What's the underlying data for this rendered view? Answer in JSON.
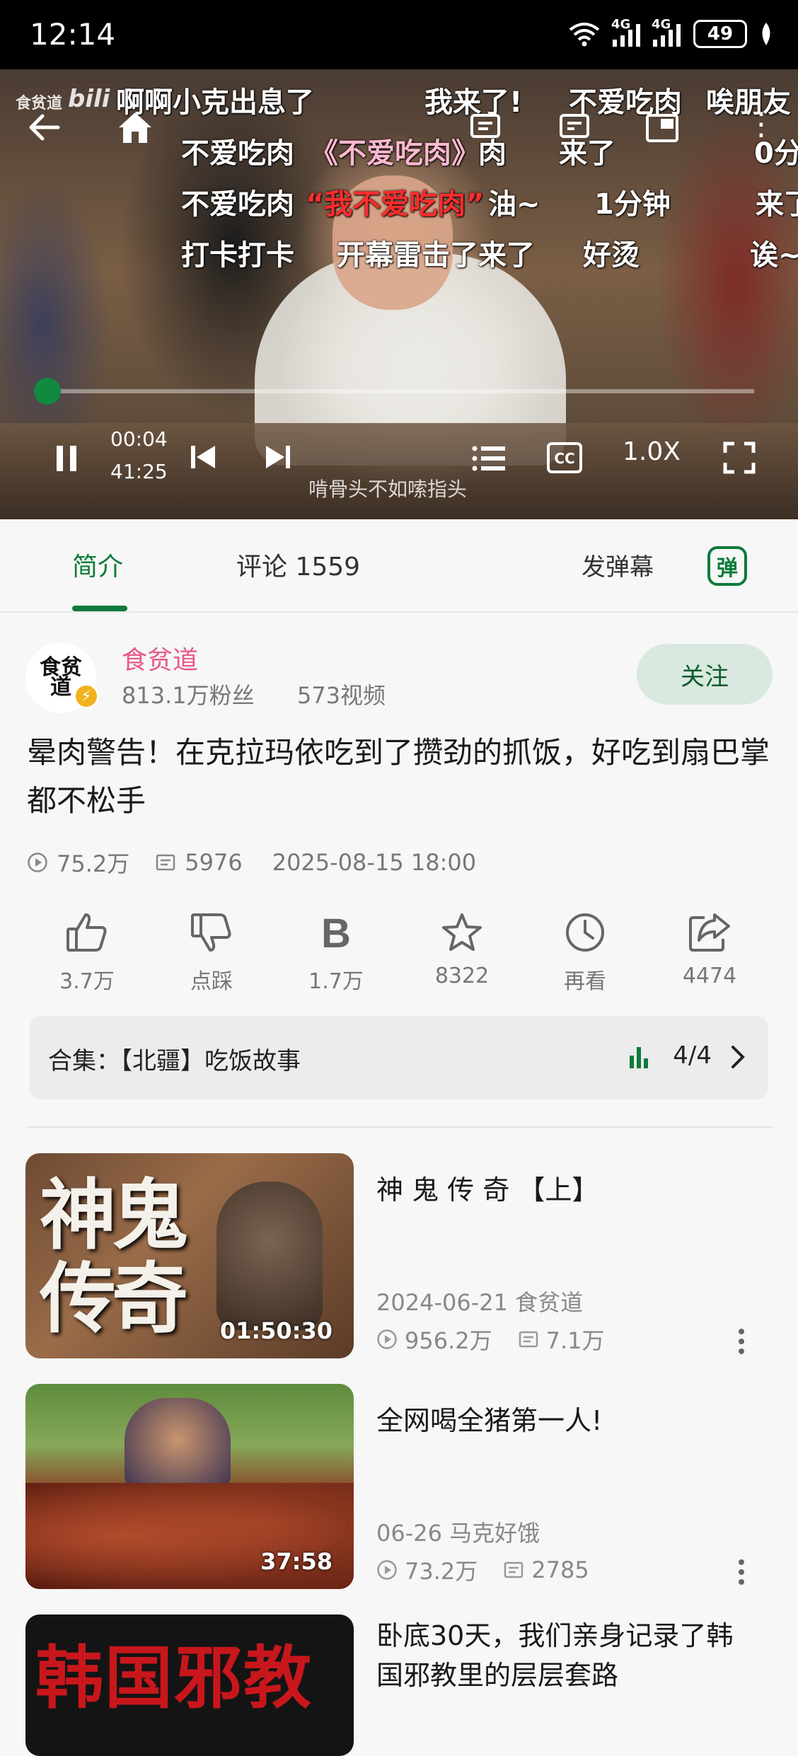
{
  "status_bar": {
    "time": "12:14",
    "battery": "49",
    "net1": "4G",
    "net2": "4G"
  },
  "video": {
    "watermark": "食贫道",
    "current_time": "00:04",
    "total_time": "41:25",
    "progress": 0.0016,
    "speed": "1.0X",
    "subtitle": "啃骨头不如嗦指头",
    "danmaku": [
      "啊啊小克出息了",
      "我来了!",
      "不爱吃肉",
      "唉朋友",
      "不爱吃肉",
      "《不爱吃肉》",
      "肉",
      "来了",
      "0分",
      "不爱吃肉",
      "“我不爱吃肉”",
      "油~",
      "1分钟",
      "来了",
      "打卡打卡",
      "开幕雷击了来了",
      "好烫",
      "诶~"
    ]
  },
  "tabs": {
    "intro": "简介",
    "comments": "评论 1559",
    "send_danmaku": "发弹幕",
    "danmaku_toggle": "弹"
  },
  "author": {
    "name": "食贫道",
    "avatar_text": "食贫道",
    "fans": "813.1万粉丝",
    "videos": "573视频",
    "follow": "关注"
  },
  "video_info": {
    "title": "晕肉警告！在克拉玛依吃到了攒劲的抓饭，好吃到扇巴掌都不松手",
    "views": "75.2万",
    "danmaku_count": "5976",
    "date": "2025-08-15 18:00"
  },
  "actions": [
    {
      "label": "3.7万",
      "icon": "thumbs-up-icon"
    },
    {
      "label": "点踩",
      "icon": "thumbs-down-icon"
    },
    {
      "label": "1.7万",
      "icon": "coin-icon"
    },
    {
      "label": "8322",
      "icon": "star-icon"
    },
    {
      "label": "再看",
      "icon": "clock-icon"
    },
    {
      "label": "4474",
      "icon": "share-icon"
    }
  ],
  "collection": {
    "label": "合集：【北疆】吃饭故事",
    "count": "4/4"
  },
  "recommendations": [
    {
      "title": "神 鬼 传 奇 【上】",
      "thumb_text": "神鬼传奇",
      "duration": "01:50:30",
      "date_author": "2024-06-21  食贫道",
      "views": "956.2万",
      "danmaku": "7.1万"
    },
    {
      "title": "全网喝全猪第一人!",
      "duration": "37:58",
      "date_author": "06-26  马克好饿",
      "views": "73.2万",
      "danmaku": "2785"
    },
    {
      "title": "卧底30天，我们亲身记录了韩国邪教里的层层套路",
      "thumb_text": "韩国邪教"
    }
  ],
  "colors": {
    "accent": "#0e7a3b",
    "author_name": "#e8598a",
    "follow_bg": "#dae9df"
  }
}
